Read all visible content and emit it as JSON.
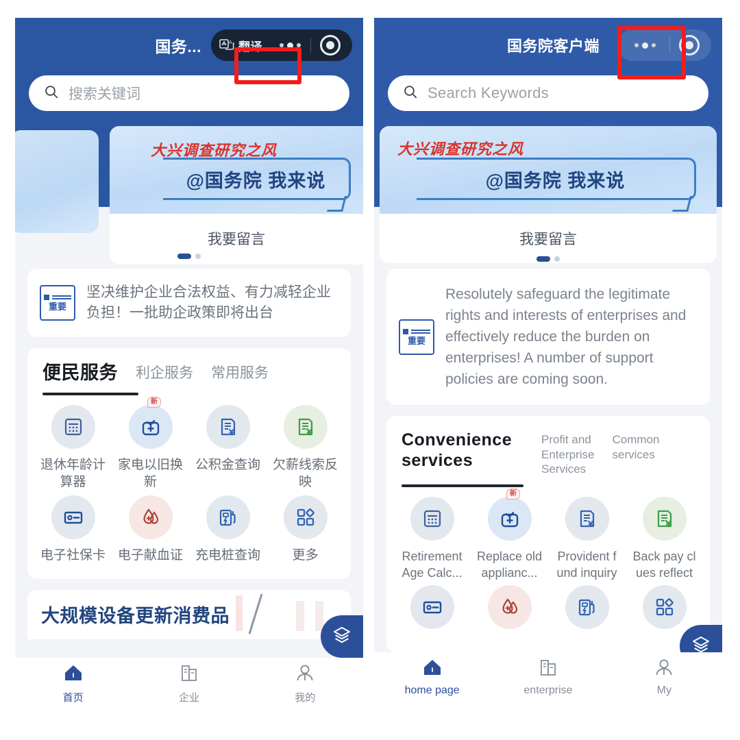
{
  "left": {
    "header": {
      "app_title": "国务...",
      "translate_label": "翻译",
      "translate_icon": "translate-icon",
      "more_icon": "more-dots-icon",
      "target_icon": "target-circle-icon"
    },
    "search": {
      "placeholder": "搜索关键词",
      "icon": "search-icon"
    },
    "banner": {
      "headline": "大兴调查研究之风",
      "bubble_text": "@国务院 我来说",
      "cta": "我要留言",
      "dots": 2,
      "active_dot": 0
    },
    "notice": {
      "badge_word": "重要",
      "text": "坚决维护企业合法权益、有力减轻企业负担！一批助企政策即将出台"
    },
    "services": {
      "tabs": [
        "便民服务",
        "利企服务",
        "常用服务"
      ],
      "active_tab": 0,
      "items": [
        {
          "label": "退休年龄计算器",
          "icon": "calculator-icon",
          "tone": "blue",
          "badge": ""
        },
        {
          "label": "家电以旧换新",
          "icon": "tv-appliance-icon",
          "tone": "blue2",
          "badge": "新"
        },
        {
          "label": "公积金查询",
          "icon": "document-yuan-icon",
          "tone": "blue",
          "badge": ""
        },
        {
          "label": "欠薪线索反映",
          "icon": "document-yuan-green-icon",
          "tone": "green",
          "badge": ""
        },
        {
          "label": "电子社保卡",
          "icon": "social-security-card-icon",
          "tone": "blue",
          "badge": ""
        },
        {
          "label": "电子献血证",
          "icon": "blood-drop-icon",
          "tone": "red",
          "badge": ""
        },
        {
          "label": "充电桩查询",
          "icon": "charging-station-icon",
          "tone": "blue",
          "badge": ""
        },
        {
          "label": "更多",
          "icon": "grid-more-icon",
          "tone": "blue",
          "badge": ""
        }
      ]
    },
    "teaser": {
      "title": "大规模设备更新消费品"
    },
    "fab": {
      "icon": "layers-icon"
    },
    "tabbar": {
      "items": [
        {
          "label": "首页",
          "icon": "home-icon",
          "active": true
        },
        {
          "label": "企业",
          "icon": "enterprise-icon",
          "active": false
        },
        {
          "label": "我的",
          "icon": "user-icon",
          "active": false
        }
      ]
    }
  },
  "right": {
    "header": {
      "app_title": "国务院客户端",
      "more_icon": "more-dots-icon",
      "target_icon": "target-circle-icon"
    },
    "search": {
      "placeholder": "Search Keywords",
      "icon": "search-icon"
    },
    "banner": {
      "headline": "大兴调查研究之风",
      "bubble_text": "@国务院 我来说",
      "cta": "我要留言",
      "dots": 2,
      "active_dot": 0
    },
    "notice": {
      "badge_word": "重要",
      "text": "Resolutely safeguard the legitimate rights and interests of enterprises and effectively reduce the burden on enterprises! A number of support policies are coming soon."
    },
    "services": {
      "tabs": [
        "Convenience services",
        "Profit and\nEnterprise\nServices",
        "Common\nservices"
      ],
      "active_tab": 0,
      "items": [
        {
          "label": "Retirement Age Calc...",
          "icon": "calculator-icon",
          "tone": "blue",
          "badge": ""
        },
        {
          "label": "Replace old applianc...",
          "icon": "tv-appliance-icon",
          "tone": "blue2",
          "badge": "新"
        },
        {
          "label": "Provident f und inquiry",
          "icon": "document-yuan-icon",
          "tone": "blue",
          "badge": ""
        },
        {
          "label": "Back pay cl ues reflect",
          "icon": "document-yuan-green-icon",
          "tone": "green",
          "badge": ""
        },
        {
          "label": "",
          "icon": "social-security-card-icon",
          "tone": "blue",
          "badge": ""
        },
        {
          "label": "",
          "icon": "blood-drop-icon",
          "tone": "red",
          "badge": ""
        },
        {
          "label": "",
          "icon": "charging-station-icon",
          "tone": "blue",
          "badge": ""
        },
        {
          "label": "",
          "icon": "grid-more-icon",
          "tone": "blue",
          "badge": ""
        }
      ]
    },
    "fab": {
      "icon": "layers-icon"
    },
    "tabbar": {
      "items": [
        {
          "label": "home page",
          "icon": "home-icon",
          "active": true
        },
        {
          "label": "enterprise",
          "icon": "enterprise-icon",
          "active": false
        },
        {
          "label": "My",
          "icon": "user-icon",
          "active": false
        }
      ]
    }
  },
  "colors": {
    "header_blue": "#2b57a2",
    "accent_blue": "#2b4f99",
    "highlight_red": "#f41c1c",
    "banner_red": "#d8332b",
    "page_bg": "#f2f4f7"
  }
}
